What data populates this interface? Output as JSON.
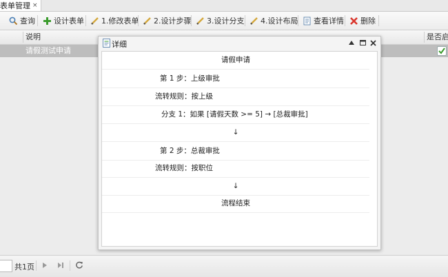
{
  "tab": {
    "title": "表单管理",
    "close": "×"
  },
  "toolbar": {
    "query": "查询",
    "design_form": "设计表单",
    "edit_form": "1.修改表单",
    "design_steps": "2.设计步骤",
    "design_branch": "3.设计分支",
    "design_layout": "4.设计布局",
    "view_detail": "查看详情",
    "delete": "删除"
  },
  "grid": {
    "headers": {
      "desc": "说明",
      "enabled": "是否启"
    },
    "row": {
      "desc": "请假测试申请"
    }
  },
  "pager": {
    "total": "共1页"
  },
  "modal": {
    "title": "详细",
    "flow": [
      {
        "text": "请假申请",
        "indent": "center"
      },
      {
        "text": "第 1 步：上级审批",
        "indent": "step"
      },
      {
        "text": "流转规则：按上级",
        "indent": "rule"
      },
      {
        "text": "分支 1：如果 [请假天数 >= 5] → [总裁审批]",
        "indent": "branch"
      },
      {
        "text": "↓",
        "indent": "center"
      },
      {
        "text": "第 2 步：总裁审批",
        "indent": "step"
      },
      {
        "text": "流转规则：按职位",
        "indent": "rule"
      },
      {
        "text": "↓",
        "indent": "center"
      },
      {
        "text": "流程结束",
        "indent": "center"
      }
    ]
  },
  "colors": {
    "selected_row": "#bdbdbd",
    "delete_red": "#d9342b",
    "add_green": "#3a9b2c"
  }
}
